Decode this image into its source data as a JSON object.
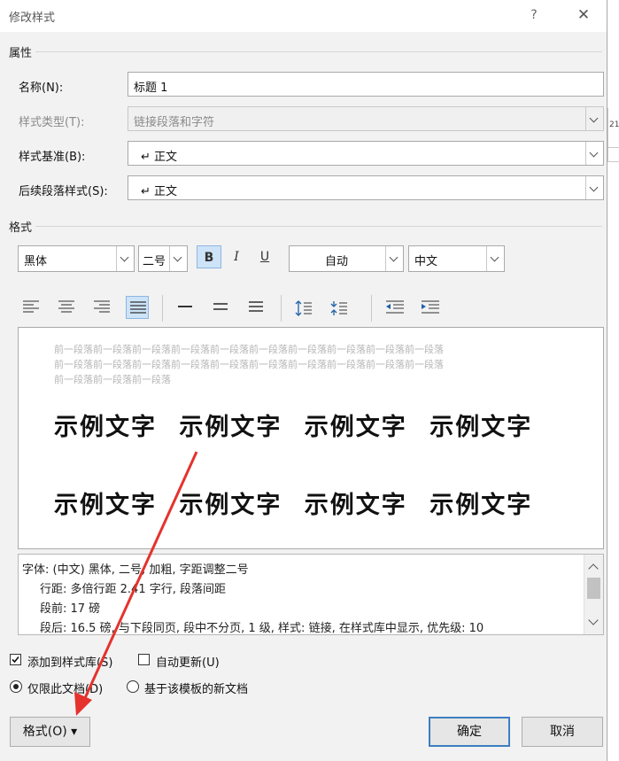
{
  "window": {
    "title": "修改样式",
    "help_glyph": "?",
    "close_glyph": "✕"
  },
  "properties": {
    "section_label": "属性",
    "name_label": "名称(N):",
    "name_value": "标题 1",
    "style_type_label": "样式类型(T):",
    "style_type_value": "链接段落和字符",
    "based_on_label": "样式基准(B):",
    "based_on_value": "↵ 正文",
    "following_label": "后续段落样式(S):",
    "following_value": "↵ 正文"
  },
  "formatting": {
    "section_label": "格式",
    "font": "黑体",
    "size": "二号",
    "bold": "B",
    "italic": "I",
    "underline": "U",
    "color": "自动",
    "script": "中文"
  },
  "preview": {
    "prev_paragraph_lines": [
      "前一段落前一段落前一段落前一段落前一段落前一段落前一段落前一段落前一段落前一段落",
      "前一段落前一段落前一段落前一段落前一段落前一段落前一段落前一段落前一段落前一段落",
      "前一段落前一段落前一段落"
    ],
    "sample_line_1": "示例文字 示例文字 示例文字 示例文字",
    "sample_line_2": "示例文字 示例文字 示例文字 示例文字"
  },
  "description": {
    "lines": [
      "字体: (中文) 黑体, 二号, 加粗, 字距调整二号",
      "行距: 多倍行距 2.41 字行, 段落间距",
      "段前: 17 磅",
      "段后: 16.5 磅, 与下段同页, 段中不分页, 1 级, 样式: 链接, 在样式库中显示, 优先级: 10"
    ]
  },
  "options": {
    "add_to_gallery": "添加到样式库(S)",
    "auto_update": "自动更新(U)",
    "only_this_doc": "仅限此文档(D)",
    "new_docs_template": "基于该模板的新文档"
  },
  "buttons": {
    "format": "格式(O) ▾",
    "ok": "确定",
    "cancel": "取消"
  },
  "background": {
    "stub_text": "21"
  },
  "colors": {
    "accent": "#3c7fc0",
    "selected_bg": "#cde3f8",
    "arrow": "#e5322d"
  }
}
